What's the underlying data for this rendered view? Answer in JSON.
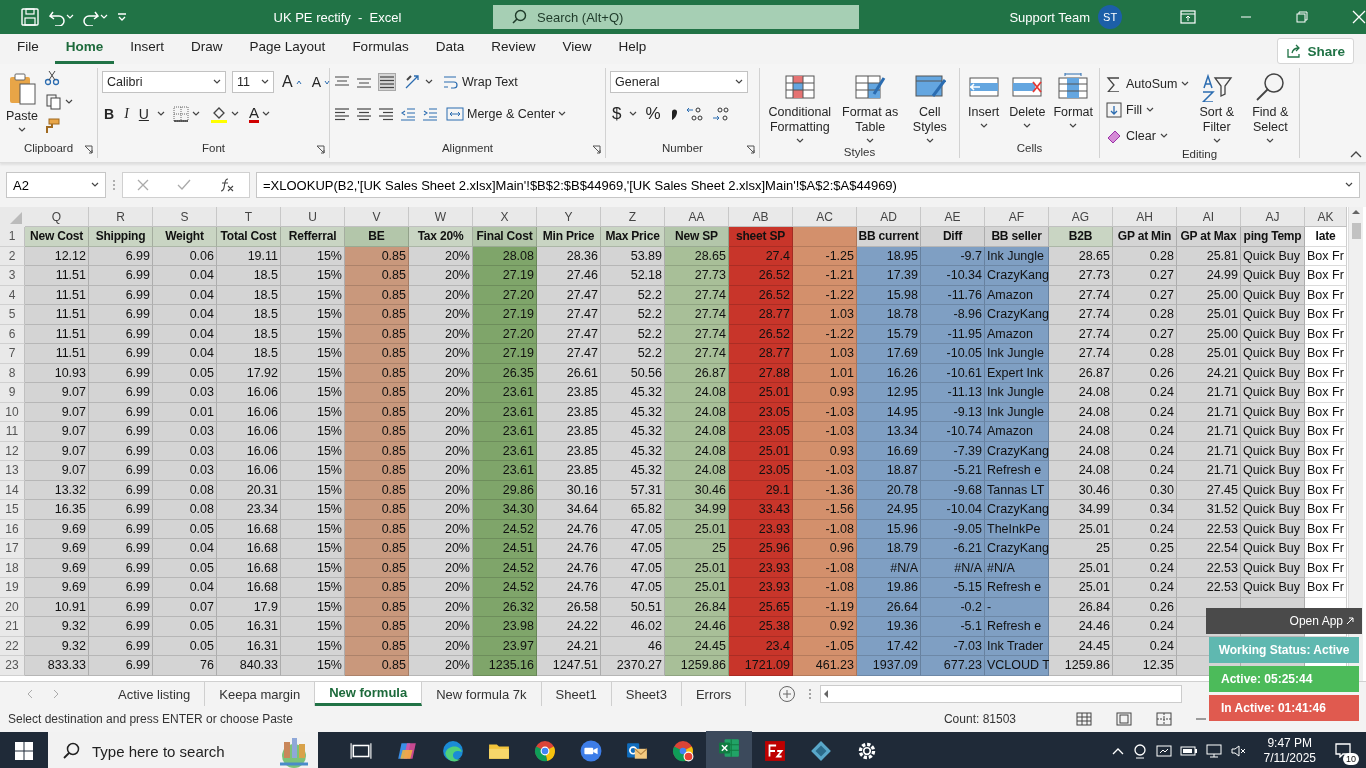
{
  "title_bar": {
    "title": "UK PE rectify  -  Excel",
    "search": {
      "placeholder": "Search (Alt+Q)"
    },
    "user": "Support Team",
    "avatar": "ST"
  },
  "menu_tabs": [
    {
      "label": "File",
      "selected": false
    },
    {
      "label": "Home",
      "selected": true
    },
    {
      "label": "Insert",
      "selected": false
    },
    {
      "label": "Draw",
      "selected": false
    },
    {
      "label": "Page Layout",
      "selected": false
    },
    {
      "label": "Formulas",
      "selected": false
    },
    {
      "label": "Data",
      "selected": false
    },
    {
      "label": "Review",
      "selected": false
    },
    {
      "label": "View",
      "selected": false
    },
    {
      "label": "Help",
      "selected": false
    }
  ],
  "share": "Share",
  "ribbon": {
    "clipboard": {
      "label": "Clipboard",
      "paste": "Paste"
    },
    "font": {
      "label": "Font",
      "font_name": "Calibri",
      "font_size": "11",
      "grow": "A",
      "shrink": "A",
      "bold": "B",
      "italic": "I",
      "underline": "U",
      "font_color": "A"
    },
    "alignment": {
      "label": "Alignment",
      "wrap_text": "Wrap Text",
      "merge": "Merge & Center"
    },
    "number": {
      "label": "Number",
      "format": "General",
      "currency": "$",
      "percent": "%"
    },
    "styles": {
      "label": "Styles",
      "buttons": [
        "Conditional Formatting",
        "Format as Table",
        "Cell Styles"
      ]
    },
    "cells": {
      "label": "Cells",
      "buttons": [
        "Insert",
        "Delete",
        "Format"
      ]
    },
    "editing": {
      "label": "Editing",
      "small": [
        "AutoSum",
        "Fill",
        "Clear"
      ],
      "buttons": [
        "Sort & Filter",
        "Find & Select"
      ]
    }
  },
  "formula_bar": {
    "name_box": "A2",
    "formula": "=XLOOKUP(B2,'[UK Sales Sheet 2.xlsx]Main'!$B$2:$B$44969,'[UK Sales Sheet 2.xlsx]Main'!$A$2:$A$44969)"
  },
  "sheet": {
    "header_row_number": "1",
    "columns": [
      {
        "letter": "Q",
        "header": {
          "text": "New Cost",
          "color": "#c9d5c3"
        },
        "kind": "number",
        "color": "#d4d4d4"
      },
      {
        "letter": "R",
        "header": {
          "text": "Shipping",
          "color": "#c9d5c3"
        },
        "kind": "number",
        "color": "#d4d4d4"
      },
      {
        "letter": "S",
        "header": {
          "text": "Weight",
          "color": "#c9d5c3"
        },
        "kind": "number",
        "color": "#d4d4d4"
      },
      {
        "letter": "T",
        "header": {
          "text": "Total Cost",
          "color": "#c9d5c3"
        },
        "kind": "number",
        "color": "#d4d4d4"
      },
      {
        "letter": "U",
        "header": {
          "text": "Refferral",
          "color": "#c9d5c3"
        },
        "kind": "number",
        "color": "#d4d4d4"
      },
      {
        "letter": "V",
        "header": {
          "text": "BE",
          "color": "#b3c6aa"
        },
        "kind": "number",
        "color": "#c9987c"
      },
      {
        "letter": "W",
        "header": {
          "text": "Tax 20%",
          "color": "#c9d5c3"
        },
        "kind": "number",
        "color": "#d4d4d4"
      },
      {
        "letter": "X",
        "header": {
          "text": "Final Cost",
          "color": "#b3c6aa"
        },
        "kind": "number",
        "color": "#7fa56a"
      },
      {
        "letter": "Y",
        "header": {
          "text": "Min Price",
          "color": "#c9d5c3"
        },
        "kind": "number",
        "color": "#d4d4d4"
      },
      {
        "letter": "Z",
        "header": {
          "text": "Max Price",
          "color": "#c9d5c3"
        },
        "kind": "number",
        "color": "#d4d4d4"
      },
      {
        "letter": "AA",
        "header": {
          "text": "New SP",
          "color": "#b3c6aa"
        },
        "kind": "number",
        "color": "#a8bf98"
      },
      {
        "letter": "AB",
        "header": {
          "text": "sheet SP",
          "color": "#c8352a"
        },
        "kind": "number",
        "color": "#c8352a"
      },
      {
        "letter": "AC",
        "header": {
          "color": "#d3906c"
        },
        "kind": "number",
        "color": "#d3906c"
      },
      {
        "letter": "AD",
        "header": {
          "text": "BB current",
          "color": "#d4d4d4"
        },
        "kind": "number",
        "color": "#7f9fc3"
      },
      {
        "letter": "AE",
        "header": {
          "text": "Diff",
          "color": "#d4d4d4"
        },
        "kind": "number",
        "color": "#7f9fc3"
      },
      {
        "letter": "AF",
        "header": {
          "text": "BB seller",
          "color": "#d4d4d4"
        },
        "kind": "text",
        "color": "#7f9fc3"
      },
      {
        "letter": "AG",
        "header": {
          "text": "B2B",
          "color": "#c9d5c3"
        },
        "kind": "number",
        "color": "#d4d4d4"
      },
      {
        "letter": "AH",
        "header": {
          "text": "GP at Min",
          "color": "#d4d4d4"
        },
        "kind": "number",
        "color": "#d4d4d4"
      },
      {
        "letter": "AI",
        "header": {
          "text": "GP at Max",
          "color": "#d4d4d4"
        },
        "kind": "number",
        "color": "#d4d4d4"
      },
      {
        "letter": "AJ",
        "header": {
          "text": "ping Temp",
          "color": "#d4d4d4"
        },
        "kind": "text",
        "color": "#d4d4d4"
      },
      {
        "letter": "AK",
        "header": {
          "text": "late",
          "color": "#ffffff"
        },
        "kind": "text",
        "color": "#ffffff"
      }
    ],
    "rows": [
      {
        "number": "2",
        "cells": [
          "12.12",
          "6.99",
          "0.06",
          "19.11",
          "15%",
          "0.85",
          "20%",
          "28.08",
          "28.36",
          "53.89",
          "28.65",
          "27.4",
          "-1.25",
          "18.95",
          "-9.7",
          "Ink Jungle",
          "28.65",
          "0.28",
          "25.81",
          "Quick Buy",
          "Box Fr"
        ]
      },
      {
        "number": "3",
        "cells": [
          "11.51",
          "6.99",
          "0.04",
          "18.5",
          "15%",
          "0.85",
          "20%",
          "27.19",
          "27.46",
          "52.18",
          "27.73",
          "26.52",
          "-1.21",
          "17.39",
          "-10.34",
          "CrazyKang",
          "27.73",
          "0.27",
          "24.99",
          "Quick Buy",
          "Box Fr"
        ]
      },
      {
        "number": "4",
        "cells": [
          "11.51",
          "6.99",
          "0.04",
          "18.5",
          "15%",
          "0.85",
          "20%",
          "27.20",
          "27.47",
          "52.2",
          "27.74",
          "26.52",
          "-1.22",
          "15.98",
          "-11.76",
          "Amazon",
          "27.74",
          "0.27",
          "25.00",
          "Quick Buy",
          "Box Fr"
        ]
      },
      {
        "number": "5",
        "cells": [
          "11.51",
          "6.99",
          "0.04",
          "18.5",
          "15%",
          "0.85",
          "20%",
          "27.19",
          "27.47",
          "52.2",
          "27.74",
          "28.77",
          "1.03",
          "18.78",
          "-8.96",
          "CrazyKang",
          "27.74",
          "0.28",
          "25.01",
          "Quick Buy",
          "Box Fr"
        ]
      },
      {
        "number": "6",
        "cells": [
          "11.51",
          "6.99",
          "0.04",
          "18.5",
          "15%",
          "0.85",
          "20%",
          "27.20",
          "27.47",
          "52.2",
          "27.74",
          "26.52",
          "-1.22",
          "15.79",
          "-11.95",
          "Amazon",
          "27.74",
          "0.27",
          "25.00",
          "Quick Buy",
          "Box Fr"
        ]
      },
      {
        "number": "7",
        "cells": [
          "11.51",
          "6.99",
          "0.04",
          "18.5",
          "15%",
          "0.85",
          "20%",
          "27.19",
          "27.47",
          "52.2",
          "27.74",
          "28.77",
          "1.03",
          "17.69",
          "-10.05",
          "Ink Jungle",
          "27.74",
          "0.28",
          "25.01",
          "Quick Buy",
          "Box Fr"
        ]
      },
      {
        "number": "8",
        "cells": [
          "10.93",
          "6.99",
          "0.05",
          "17.92",
          "15%",
          "0.85",
          "20%",
          "26.35",
          "26.61",
          "50.56",
          "26.87",
          "27.88",
          "1.01",
          "16.26",
          "-10.61",
          "Expert Ink",
          "26.87",
          "0.26",
          "24.21",
          "Quick Buy",
          "Box Fr"
        ]
      },
      {
        "number": "9",
        "cells": [
          "9.07",
          "6.99",
          "0.03",
          "16.06",
          "15%",
          "0.85",
          "20%",
          "23.61",
          "23.85",
          "45.32",
          "24.08",
          "25.01",
          "0.93",
          "12.95",
          "-11.13",
          "Ink Jungle",
          "24.08",
          "0.24",
          "21.71",
          "Quick Buy",
          "Box Fr"
        ]
      },
      {
        "number": "10",
        "cells": [
          "9.07",
          "6.99",
          "0.01",
          "16.06",
          "15%",
          "0.85",
          "20%",
          "23.61",
          "23.85",
          "45.32",
          "24.08",
          "23.05",
          "-1.03",
          "14.95",
          "-9.13",
          "Ink Jungle",
          "24.08",
          "0.24",
          "21.71",
          "Quick Buy",
          "Box Fr"
        ]
      },
      {
        "number": "11",
        "cells": [
          "9.07",
          "6.99",
          "0.03",
          "16.06",
          "15%",
          "0.85",
          "20%",
          "23.61",
          "23.85",
          "45.32",
          "24.08",
          "23.05",
          "-1.03",
          "13.34",
          "-10.74",
          "Amazon",
          "24.08",
          "0.24",
          "21.71",
          "Quick Buy",
          "Box Fr"
        ]
      },
      {
        "number": "12",
        "cells": [
          "9.07",
          "6.99",
          "0.03",
          "16.06",
          "15%",
          "0.85",
          "20%",
          "23.61",
          "23.85",
          "45.32",
          "24.08",
          "25.01",
          "0.93",
          "16.69",
          "-7.39",
          "CrazyKang",
          "24.08",
          "0.24",
          "21.71",
          "Quick Buy",
          "Box Fr"
        ]
      },
      {
        "number": "13",
        "cells": [
          "9.07",
          "6.99",
          "0.03",
          "16.06",
          "15%",
          "0.85",
          "20%",
          "23.61",
          "23.85",
          "45.32",
          "24.08",
          "23.05",
          "-1.03",
          "18.87",
          "-5.21",
          "Refresh e",
          "24.08",
          "0.24",
          "21.71",
          "Quick Buy",
          "Box Fr"
        ]
      },
      {
        "number": "14",
        "cells": [
          "13.32",
          "6.99",
          "0.08",
          "20.31",
          "15%",
          "0.85",
          "20%",
          "29.86",
          "30.16",
          "57.31",
          "30.46",
          "29.1",
          "-1.36",
          "20.78",
          "-9.68",
          "Tannas LT",
          "30.46",
          "0.30",
          "27.45",
          "Quick Buy",
          "Box Fr"
        ]
      },
      {
        "number": "15",
        "cells": [
          "16.35",
          "6.99",
          "0.08",
          "23.34",
          "15%",
          "0.85",
          "20%",
          "34.30",
          "34.64",
          "65.82",
          "34.99",
          "33.43",
          "-1.56",
          "24.95",
          "-10.04",
          "CrazyKang",
          "34.99",
          "0.34",
          "31.52",
          "Quick Buy",
          "Box Fr"
        ]
      },
      {
        "number": "16",
        "cells": [
          "9.69",
          "6.99",
          "0.05",
          "16.68",
          "15%",
          "0.85",
          "20%",
          "24.52",
          "24.76",
          "47.05",
          "25.01",
          "23.93",
          "-1.08",
          "15.96",
          "-9.05",
          "TheInkPe",
          "25.01",
          "0.24",
          "22.53",
          "Quick Buy",
          "Box Fr"
        ]
      },
      {
        "number": "17",
        "cells": [
          "9.69",
          "6.99",
          "0.04",
          "16.68",
          "15%",
          "0.85",
          "20%",
          "24.51",
          "24.76",
          "47.05",
          "25",
          "25.96",
          "0.96",
          "18.79",
          "-6.21",
          "CrazyKang",
          "25",
          "0.25",
          "22.54",
          "Quick Buy",
          "Box Fr"
        ]
      },
      {
        "number": "18",
        "cells": [
          "9.69",
          "6.99",
          "0.05",
          "16.68",
          "15%",
          "0.85",
          "20%",
          "24.52",
          "24.76",
          "47.05",
          "25.01",
          "23.93",
          "-1.08",
          "#N/A",
          "#N/A",
          "#N/A",
          "25.01",
          "0.24",
          "22.53",
          "Quick Buy",
          "Box Fr"
        ]
      },
      {
        "number": "19",
        "cells": [
          "9.69",
          "6.99",
          "0.04",
          "16.68",
          "15%",
          "0.85",
          "20%",
          "24.52",
          "24.76",
          "47.05",
          "25.01",
          "23.93",
          "-1.08",
          "19.86",
          "-5.15",
          "Refresh e",
          "25.01",
          "0.24",
          "22.53",
          "Quick Buy",
          "Box Fr"
        ]
      },
      {
        "number": "20",
        "cells": [
          "10.91",
          "6.99",
          "0.07",
          "17.9",
          "15%",
          "0.85",
          "20%",
          "26.32",
          "26.58",
          "50.51",
          "26.84",
          "25.65",
          "-1.19",
          "26.64",
          "-0.2",
          "-",
          "26.84",
          "0.26"
        ]
      },
      {
        "number": "21",
        "cells": [
          "9.32",
          "6.99",
          "0.05",
          "16.31",
          "15%",
          "0.85",
          "20%",
          "23.98",
          "24.22",
          "46.02",
          "24.46",
          "25.38",
          "0.92",
          "19.36",
          "-5.1",
          "Refresh e",
          "24.46",
          "0.24"
        ]
      },
      {
        "number": "22",
        "cells": [
          "9.32",
          "6.99",
          "0.05",
          "16.31",
          "15%",
          "0.85",
          "20%",
          "23.97",
          "24.21",
          "46",
          "24.45",
          "23.4",
          "-1.05",
          "17.42",
          "-7.03",
          "Ink Trader",
          "24.45",
          "0.24"
        ]
      },
      {
        "number": "23",
        "cells": [
          "833.33",
          "6.99",
          "76",
          "840.33",
          "15%",
          "0.85",
          "20%",
          "1235.16",
          "1247.51",
          "2370.27",
          "1259.86",
          "1721.09",
          "461.23",
          "1937.09",
          "677.23",
          "VCLOUD T",
          "1259.86",
          "12.35"
        ]
      }
    ]
  },
  "sheet_tabs": [
    {
      "label": "Active listing",
      "selected": false
    },
    {
      "label": "Keepa margin",
      "selected": false
    },
    {
      "label": "New formula",
      "selected": true
    },
    {
      "label": "New formula 7k",
      "selected": false
    },
    {
      "label": "Sheet1",
      "selected": false
    },
    {
      "label": "Sheet3",
      "selected": false
    },
    {
      "label": "Errors",
      "selected": false
    }
  ],
  "status_bar": {
    "message": "Select destination and press ENTER or choose Paste",
    "count": "Count: 81503"
  },
  "tracker": {
    "open": "Open App",
    "status": "Working Status: Active",
    "active": "Active: 05:25:44",
    "inactive": "In Active: 01:41:46"
  },
  "taskbar": {
    "search": {
      "placeholder": "Type here to search"
    },
    "time": "9:47 PM",
    "date": "7/11/2025",
    "notifications": "10"
  }
}
